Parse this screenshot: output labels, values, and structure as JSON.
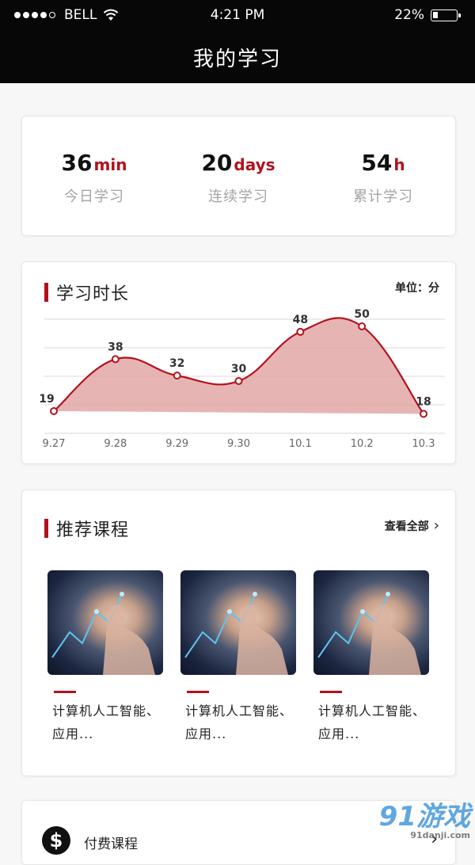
{
  "status_bar": {
    "carrier": "BELL",
    "time": "4:21 PM",
    "battery": "22%",
    "battery_level": 0.22,
    "signal_dots": [
      true,
      true,
      true,
      true,
      false
    ]
  },
  "nav": {
    "title": "我的学习"
  },
  "stats": [
    {
      "value": "36",
      "unit": "min",
      "label": "今日学习"
    },
    {
      "value": "20",
      "unit": "days",
      "label": "连续学习"
    },
    {
      "value": "54",
      "unit": "h",
      "label": "累计学习"
    }
  ],
  "study_chart": {
    "title": "学习时长",
    "unit_label": "单位：分"
  },
  "chart_data": {
    "type": "area",
    "categories": [
      "9.27",
      "9.28",
      "9.29",
      "9.30",
      "10.1",
      "10.2",
      "10.3"
    ],
    "series": [
      {
        "values": [
          19,
          38,
          32,
          30,
          48,
          50,
          18
        ]
      }
    ],
    "grid": true,
    "colors": {
      "line": "#b3121d",
      "fill": "#e3a7a7"
    }
  },
  "courses": {
    "title": "推荐课程",
    "view_all": "查看全部",
    "items": [
      {
        "title_line1": "计算机人工智能、",
        "title_line2": "应用..."
      },
      {
        "title_line1": "计算机人工智能、",
        "title_line2": "应用..."
      },
      {
        "title_line1": "计算机人工智能、",
        "title_line2": "应用..."
      }
    ]
  },
  "paid": {
    "title": "付费课程",
    "icon": "dollar-icon",
    "icon_glyph": "$"
  },
  "watermark": {
    "logo": "91游戏",
    "site": "91danji.com"
  },
  "colors": {
    "accent": "#b3121d",
    "header_bg": "#070707"
  }
}
